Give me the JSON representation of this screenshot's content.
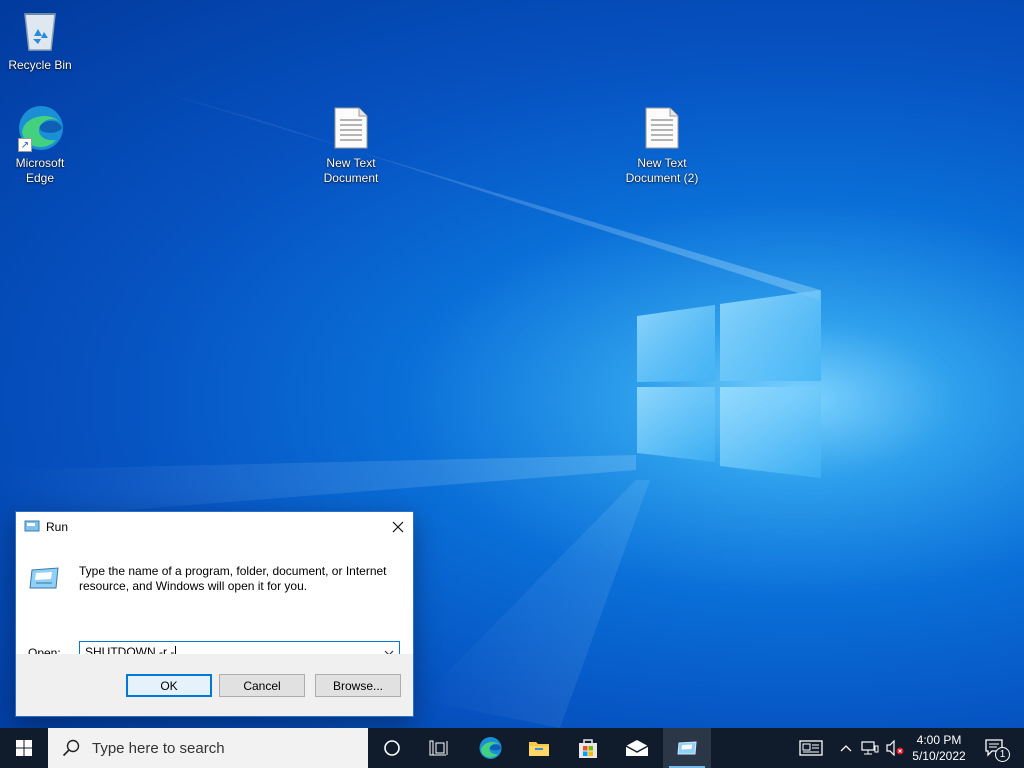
{
  "desktop": {
    "icons": [
      {
        "label": "Recycle Bin",
        "icon": "recycle-bin-icon"
      },
      {
        "label": "Microsoft\nEdge",
        "icon": "edge-icon"
      },
      {
        "label": "New Text\nDocument",
        "icon": "text-document-icon"
      },
      {
        "label": "New Text\nDocument (2)",
        "icon": "text-document-icon"
      }
    ]
  },
  "run_dialog": {
    "title": "Run",
    "description": "Type the name of a program, folder, document, or Internet resource, and Windows will open it for you.",
    "open_label": "Open:",
    "command_value": "SHUTDOWN -r -",
    "ok_label": "OK",
    "cancel_label": "Cancel",
    "browse_label": "Browse..."
  },
  "taskbar": {
    "search_placeholder": "Type here to search",
    "pinned": [
      "cortana-icon",
      "task-view-icon",
      "edge-icon",
      "file-explorer-icon",
      "microsoft-store-icon",
      "mail-icon",
      "run-icon"
    ],
    "tray": [
      "news-icon",
      "chevron-up-icon",
      "network-icon",
      "volume-muted-icon"
    ],
    "time": "4:00 PM",
    "date": "5/10/2022",
    "notification_count": "1"
  },
  "colors": {
    "accent": "#0078d7",
    "taskbar_bg": "#101c2c",
    "desktop_blue": "#0a6fd8"
  }
}
